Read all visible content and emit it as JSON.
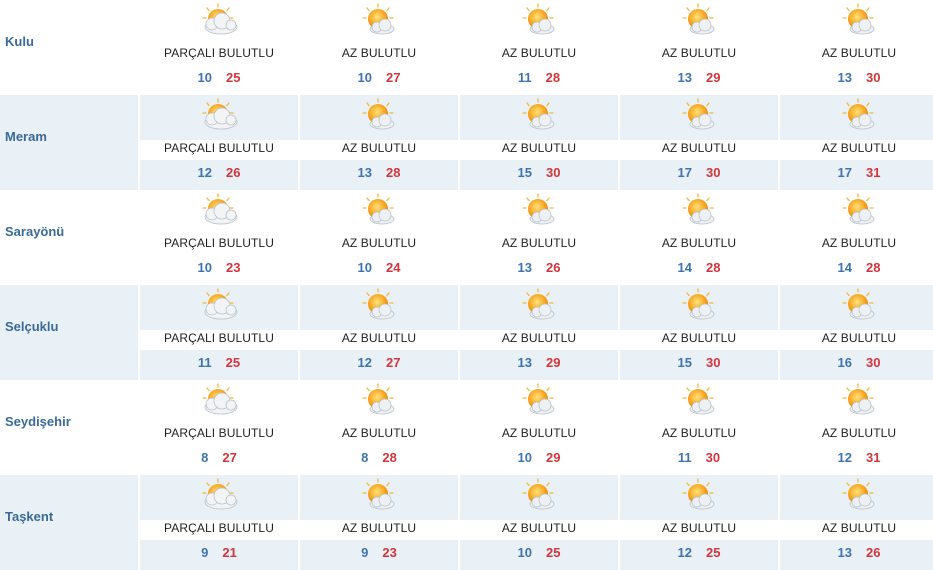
{
  "colors": {
    "shaded_row": "#e9f0f6",
    "city": "#3a6a98",
    "min_temp": "#3e74ae",
    "max_temp": "#d1353b"
  },
  "rows": [
    {
      "city": "Kulu",
      "days": [
        {
          "icon": "partly-cloudy-icon",
          "condition": "PARÇALI BULUTLU",
          "min": "10",
          "max": "25"
        },
        {
          "icon": "mostly-sunny-icon",
          "condition": "AZ BULUTLU",
          "min": "10",
          "max": "27"
        },
        {
          "icon": "mostly-sunny-icon",
          "condition": "AZ BULUTLU",
          "min": "11",
          "max": "28"
        },
        {
          "icon": "mostly-sunny-icon",
          "condition": "AZ BULUTLU",
          "min": "13",
          "max": "29"
        },
        {
          "icon": "mostly-sunny-icon",
          "condition": "AZ BULUTLU",
          "min": "13",
          "max": "30"
        }
      ]
    },
    {
      "city": "Meram",
      "days": [
        {
          "icon": "partly-cloudy-icon",
          "condition": "PARÇALI BULUTLU",
          "min": "12",
          "max": "26"
        },
        {
          "icon": "mostly-sunny-icon",
          "condition": "AZ BULUTLU",
          "min": "13",
          "max": "28"
        },
        {
          "icon": "mostly-sunny-icon",
          "condition": "AZ BULUTLU",
          "min": "15",
          "max": "30"
        },
        {
          "icon": "mostly-sunny-icon",
          "condition": "AZ BULUTLU",
          "min": "17",
          "max": "30"
        },
        {
          "icon": "mostly-sunny-icon",
          "condition": "AZ BULUTLU",
          "min": "17",
          "max": "31"
        }
      ]
    },
    {
      "city": "Sarayönü",
      "days": [
        {
          "icon": "partly-cloudy-icon",
          "condition": "PARÇALI BULUTLU",
          "min": "10",
          "max": "23"
        },
        {
          "icon": "mostly-sunny-icon",
          "condition": "AZ BULUTLU",
          "min": "10",
          "max": "24"
        },
        {
          "icon": "mostly-sunny-icon",
          "condition": "AZ BULUTLU",
          "min": "13",
          "max": "26"
        },
        {
          "icon": "mostly-sunny-icon",
          "condition": "AZ BULUTLU",
          "min": "14",
          "max": "28"
        },
        {
          "icon": "mostly-sunny-icon",
          "condition": "AZ BULUTLU",
          "min": "14",
          "max": "28"
        }
      ]
    },
    {
      "city": "Selçuklu",
      "days": [
        {
          "icon": "partly-cloudy-icon",
          "condition": "PARÇALI BULUTLU",
          "min": "11",
          "max": "25"
        },
        {
          "icon": "mostly-sunny-icon",
          "condition": "AZ BULUTLU",
          "min": "12",
          "max": "27"
        },
        {
          "icon": "mostly-sunny-icon",
          "condition": "AZ BULUTLU",
          "min": "13",
          "max": "29"
        },
        {
          "icon": "mostly-sunny-icon",
          "condition": "AZ BULUTLU",
          "min": "15",
          "max": "30"
        },
        {
          "icon": "mostly-sunny-icon",
          "condition": "AZ BULUTLU",
          "min": "16",
          "max": "30"
        }
      ]
    },
    {
      "city": "Seydişehir",
      "days": [
        {
          "icon": "partly-cloudy-icon",
          "condition": "PARÇALI BULUTLU",
          "min": "8",
          "max": "27"
        },
        {
          "icon": "mostly-sunny-icon",
          "condition": "AZ BULUTLU",
          "min": "8",
          "max": "28"
        },
        {
          "icon": "mostly-sunny-icon",
          "condition": "AZ BULUTLU",
          "min": "10",
          "max": "29"
        },
        {
          "icon": "mostly-sunny-icon",
          "condition": "AZ BULUTLU",
          "min": "11",
          "max": "30"
        },
        {
          "icon": "mostly-sunny-icon",
          "condition": "AZ BULUTLU",
          "min": "12",
          "max": "31"
        }
      ]
    },
    {
      "city": "Taşkent",
      "days": [
        {
          "icon": "partly-cloudy-icon",
          "condition": "PARÇALI BULUTLU",
          "min": "9",
          "max": "21"
        },
        {
          "icon": "mostly-sunny-icon",
          "condition": "AZ BULUTLU",
          "min": "9",
          "max": "23"
        },
        {
          "icon": "mostly-sunny-icon",
          "condition": "AZ BULUTLU",
          "min": "10",
          "max": "25"
        },
        {
          "icon": "mostly-sunny-icon",
          "condition": "AZ BULUTLU",
          "min": "12",
          "max": "25"
        },
        {
          "icon": "mostly-sunny-icon",
          "condition": "AZ BULUTLU",
          "min": "13",
          "max": "26"
        }
      ]
    }
  ]
}
